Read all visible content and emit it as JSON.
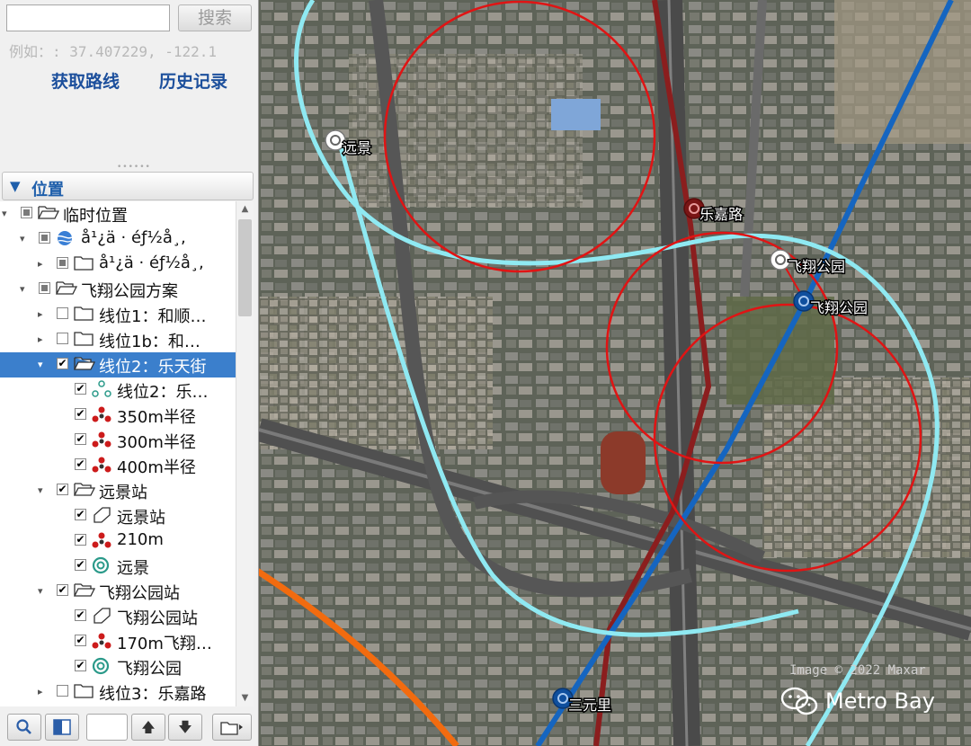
{
  "search": {
    "input_value": "",
    "button_label": "搜索",
    "example": "例如：: 37.407229, -122.1"
  },
  "links": {
    "get_route": "获取路线",
    "history": "历史记录"
  },
  "places_panel": {
    "title": "位置"
  },
  "tree": [
    {
      "label": "临时位置",
      "checkbox": "partial",
      "expand": "▾",
      "icon": "folder-open-icon"
    },
    {
      "label": "å¹¿ä · éƒ½å¸‚",
      "checkbox": "partial",
      "expand": "▾",
      "icon": "globe-icon"
    },
    {
      "label": "å¹¿ä · éƒ½å¸‚",
      "checkbox": "partial",
      "expand": "▸",
      "icon": "folder-icon"
    },
    {
      "label": "飞翔公园方案",
      "checkbox": "partial",
      "expand": "▾",
      "icon": "folder-open-icon"
    },
    {
      "label": "线位1：和顺…",
      "checkbox": "unchecked",
      "expand": "▸",
      "icon": "folder-icon"
    },
    {
      "label": "线位1b：和…",
      "checkbox": "unchecked",
      "expand": "▸",
      "icon": "folder-icon"
    },
    {
      "label": "线位2：乐天街",
      "checkbox": "checked",
      "expand": "▾",
      "icon": "folder-open-icon",
      "selected": true
    },
    {
      "label": "线位2：乐…",
      "checkbox": "checked",
      "expand": "",
      "icon": "path-icon"
    },
    {
      "label": "350m半径",
      "checkbox": "checked",
      "expand": "",
      "icon": "polygon-marker-icon"
    },
    {
      "label": "300m半径",
      "checkbox": "checked",
      "expand": "",
      "icon": "polygon-marker-icon"
    },
    {
      "label": "400m半径",
      "checkbox": "checked",
      "expand": "",
      "icon": "polygon-marker-icon"
    },
    {
      "label": "远景站",
      "checkbox": "checked",
      "expand": "▾",
      "icon": "folder-open-icon"
    },
    {
      "label": "远景站",
      "checkbox": "checked",
      "expand": "",
      "icon": "polygon-icon"
    },
    {
      "label": "210m",
      "checkbox": "checked",
      "expand": "",
      "icon": "polygon-marker-icon"
    },
    {
      "label": "远景",
      "checkbox": "checked",
      "expand": "",
      "icon": "placemark-circle-icon"
    },
    {
      "label": "飞翔公园站",
      "checkbox": "checked",
      "expand": "▾",
      "icon": "folder-open-icon"
    },
    {
      "label": "飞翔公园站",
      "checkbox": "checked",
      "expand": "",
      "icon": "polygon-icon"
    },
    {
      "label": "170m飞翔…",
      "checkbox": "checked",
      "expand": "",
      "icon": "polygon-marker-icon"
    },
    {
      "label": "飞翔公园",
      "checkbox": "checked",
      "expand": "",
      "icon": "placemark-circle-icon"
    },
    {
      "label": "线位3：乐嘉路",
      "checkbox": "unchecked",
      "expand": "▸",
      "icon": "folder-icon"
    }
  ],
  "map": {
    "labels": {
      "yuanjing": "远景",
      "lejia": "乐嘉路",
      "feixiang_park_1": "飞翔公园",
      "feixiang_park_2": "飞翔公园",
      "sanyuanli": "三元里"
    },
    "attribution": "Image © 2022 Maxar",
    "watermark": "Metro Bay",
    "colors": {
      "circle": "#e01414",
      "line_cyan": "#8fe9f2",
      "line_blue": "#1565c0",
      "line_brown": "#8b1e1e",
      "line_orange": "#f26b0f"
    }
  }
}
